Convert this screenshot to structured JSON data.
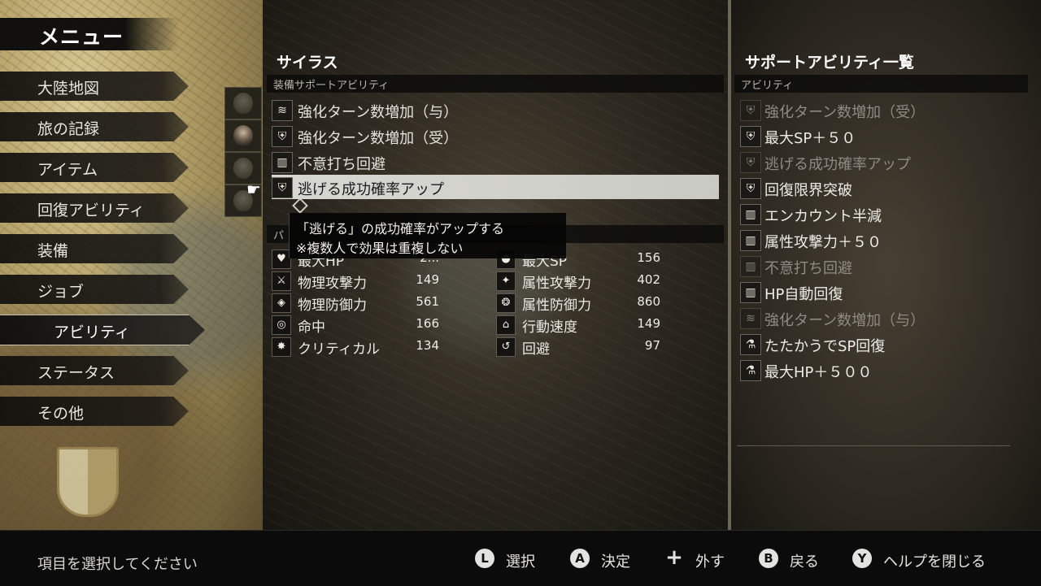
{
  "menu": {
    "title": "メニュー",
    "items": [
      {
        "label": "大陸地図"
      },
      {
        "label": "旅の記録"
      },
      {
        "label": "アイテム"
      },
      {
        "label": "回復アビリティ"
      },
      {
        "label": "装備"
      },
      {
        "label": "ジョブ"
      },
      {
        "label": "アビリティ",
        "selected": true
      },
      {
        "label": "ステータス"
      },
      {
        "label": "その他"
      }
    ]
  },
  "character": {
    "name": "サイラス",
    "equipped_header": "装備サポートアビリティ",
    "equipped": [
      {
        "icon": "fan-icon",
        "name": "強化ターン数増加（与）"
      },
      {
        "icon": "shield-icon",
        "name": "強化ターン数増加（受）"
      },
      {
        "icon": "book-icon",
        "name": "不意打ち回避"
      },
      {
        "icon": "shield-icon",
        "name": "逃げる成功確率アップ",
        "selected": true
      }
    ],
    "tooltip": {
      "line1": "「逃げる」の成功確率がアップする",
      "line2": "※複数人で効果は重複しない"
    },
    "params_header": "パ",
    "stats_left": [
      {
        "icon": "heart-icon",
        "name": "最大HP",
        "value": "2..."
      },
      {
        "icon": "sword-icon",
        "name": "物理攻撃力",
        "value": "149"
      },
      {
        "icon": "armor-icon",
        "name": "物理防御力",
        "value": "561"
      },
      {
        "icon": "target-icon",
        "name": "命中",
        "value": "166"
      },
      {
        "icon": "spark-icon",
        "name": "クリティカル",
        "value": "134"
      }
    ],
    "stats_right": [
      {
        "icon": "drop-icon",
        "name": "最大SP",
        "value": "156"
      },
      {
        "icon": "magic-icon",
        "name": "属性攻撃力",
        "value": "402"
      },
      {
        "icon": "ward-icon",
        "name": "属性防御力",
        "value": "860"
      },
      {
        "icon": "boot-icon",
        "name": "行動速度",
        "value": "149"
      },
      {
        "icon": "evade-icon",
        "name": "回避",
        "value": "97"
      }
    ]
  },
  "support_list": {
    "title": "サポートアビリティ一覧",
    "header": "アビリティ",
    "items": [
      {
        "icon": "shield-icon",
        "name": "強化ターン数増加（受）",
        "dim": true
      },
      {
        "icon": "shield-icon",
        "name": "最大SP＋５０",
        "dim": false
      },
      {
        "icon": "shield-icon",
        "name": "逃げる成功確率アップ",
        "dim": true
      },
      {
        "icon": "shield-icon",
        "name": "回復限界突破",
        "dim": false
      },
      {
        "icon": "book-icon",
        "name": "エンカウント半減",
        "dim": false
      },
      {
        "icon": "book-icon",
        "name": "属性攻撃力＋５０",
        "dim": false
      },
      {
        "icon": "book-icon",
        "name": "不意打ち回避",
        "dim": true
      },
      {
        "icon": "book-icon",
        "name": "HP自動回復",
        "dim": false
      },
      {
        "icon": "fan-icon",
        "name": "強化ターン数増加（与）",
        "dim": true
      },
      {
        "icon": "flask-icon",
        "name": "たたかうでSP回復",
        "dim": false
      },
      {
        "icon": "flask-icon",
        "name": "最大HP＋５００",
        "dim": false
      }
    ]
  },
  "footer": {
    "hint": "項目を選択してください",
    "controls": [
      {
        "button": "L",
        "label": "選択"
      },
      {
        "button": "A",
        "label": "決定"
      },
      {
        "button": "+",
        "label": "外す"
      },
      {
        "button": "B",
        "label": "戻る"
      },
      {
        "button": "Y",
        "label": "ヘルプを閉じる"
      }
    ]
  }
}
